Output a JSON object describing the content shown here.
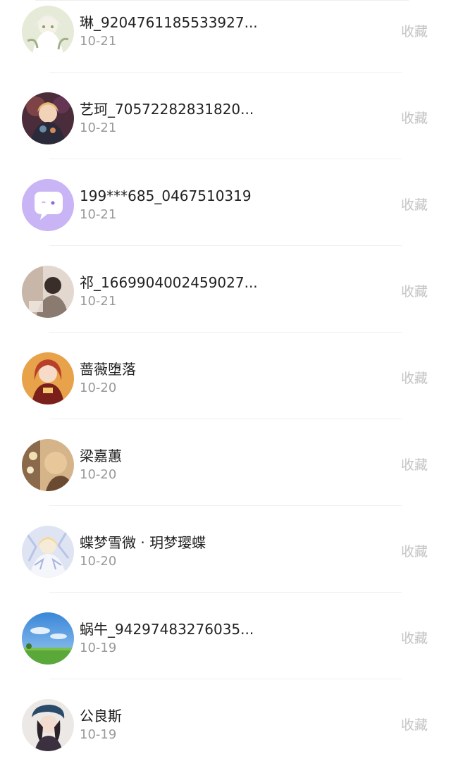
{
  "favorite_label": "收藏",
  "users": [
    {
      "name": "琳_9204761185533927...",
      "date": "10-21",
      "avatar": "anime-girl-white-hair"
    },
    {
      "name": "艺珂_70572282831820...",
      "date": "10-21",
      "avatar": "anime-girl-dark"
    },
    {
      "name": "199***685_0467510319",
      "date": "10-21",
      "avatar": "chat-bubble-icon"
    },
    {
      "name": "祁_1669904002459027...",
      "date": "10-21",
      "avatar": "photo-person"
    },
    {
      "name": "蔷薇堕落",
      "date": "10-20",
      "avatar": "anime-girl-red"
    },
    {
      "name": "梁嘉蕙",
      "date": "10-20",
      "avatar": "photo-flowers"
    },
    {
      "name": "蝶梦雪微 · 玥梦璎蝶",
      "date": "10-20",
      "avatar": "anime-girl-crystal"
    },
    {
      "name": "蜗牛_94297483276035...",
      "date": "10-19",
      "avatar": "landscape-sky-grass"
    },
    {
      "name": "公良斯",
      "date": "10-19",
      "avatar": "photo-girl-cap"
    }
  ]
}
